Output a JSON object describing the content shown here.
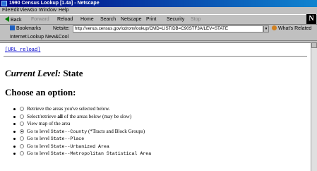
{
  "window": {
    "title": "1990 Census Lookup [1.4a] - Netscape"
  },
  "menu": [
    "File",
    "Edit",
    "View",
    "Go",
    "Window",
    "Help"
  ],
  "toolbar": {
    "back": "Back",
    "forward": "Forward",
    "reload": "Reload",
    "home": "Home",
    "search": "Search",
    "netscape": "Netscape",
    "print": "Print",
    "security": "Security",
    "stop": "Stop"
  },
  "location": {
    "bookmarks": "Bookmarks",
    "label": "Netsite:",
    "url": "http://venus.census.gov/cdrom/lookup/CMD=LIST/DB=C90STF3A/LEV=STATE",
    "related": "What's Related"
  },
  "personal": [
    "Internet",
    "Lookup",
    "New&Cool"
  ],
  "content": {
    "reload_link": "[URL reload]",
    "level_label": "Current Level:",
    "level_value": "State",
    "choose_heading": "Choose an option:",
    "options": [
      {
        "text": "Retrieve the areas you've selected below.",
        "checked": false
      },
      {
        "pre": "Select/retrieve ",
        "bold": "all",
        "post": " of the areas below  (may be slow)",
        "checked": false
      },
      {
        "text": "View map of the area",
        "checked": false
      },
      {
        "pre": "Go to level ",
        "mono": "State--County",
        "post": " (*Tracts and Block Groups)",
        "checked": true
      },
      {
        "pre": "Go to level ",
        "mono": "State--Place",
        "post": "",
        "checked": false
      },
      {
        "pre": "Go to level ",
        "mono": "State--Urbanized Area",
        "post": "",
        "checked": false
      },
      {
        "pre": "Go to level ",
        "mono": "State--Metropolitan Statistical Area",
        "post": "",
        "checked": false
      }
    ]
  }
}
